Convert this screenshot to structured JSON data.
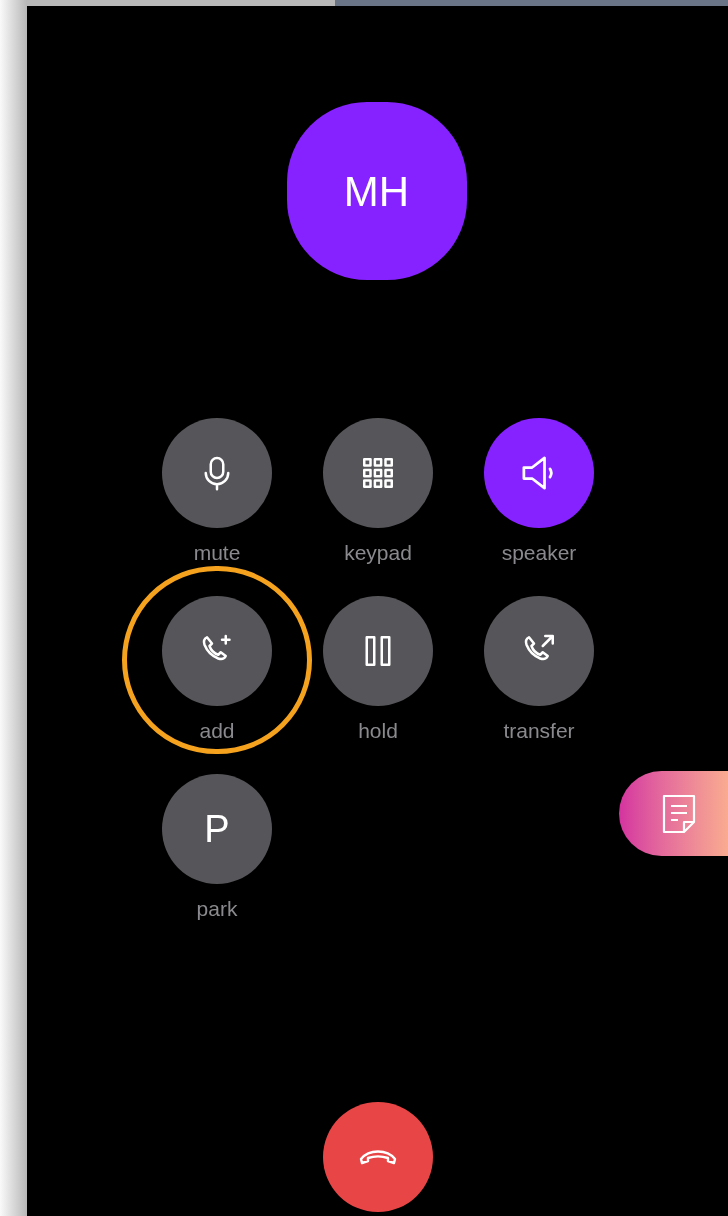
{
  "caller": {
    "initials": "MH"
  },
  "controls": [
    {
      "kind": "mic",
      "label": "mute",
      "active": false,
      "highlighted": false
    },
    {
      "kind": "keypad",
      "label": "keypad",
      "active": false,
      "highlighted": false
    },
    {
      "kind": "speaker",
      "label": "speaker",
      "active": true,
      "highlighted": false
    },
    {
      "kind": "add-call",
      "label": "add",
      "active": false,
      "highlighted": true
    },
    {
      "kind": "pause",
      "label": "hold",
      "active": false,
      "highlighted": false
    },
    {
      "kind": "transfer",
      "label": "transfer",
      "active": false,
      "highlighted": false
    },
    {
      "kind": "letter",
      "glyph": "P",
      "label": "park",
      "active": false,
      "highlighted": false
    }
  ],
  "notes_tab": {
    "kind": "notes"
  },
  "end_call": {
    "kind": "hangup"
  }
}
